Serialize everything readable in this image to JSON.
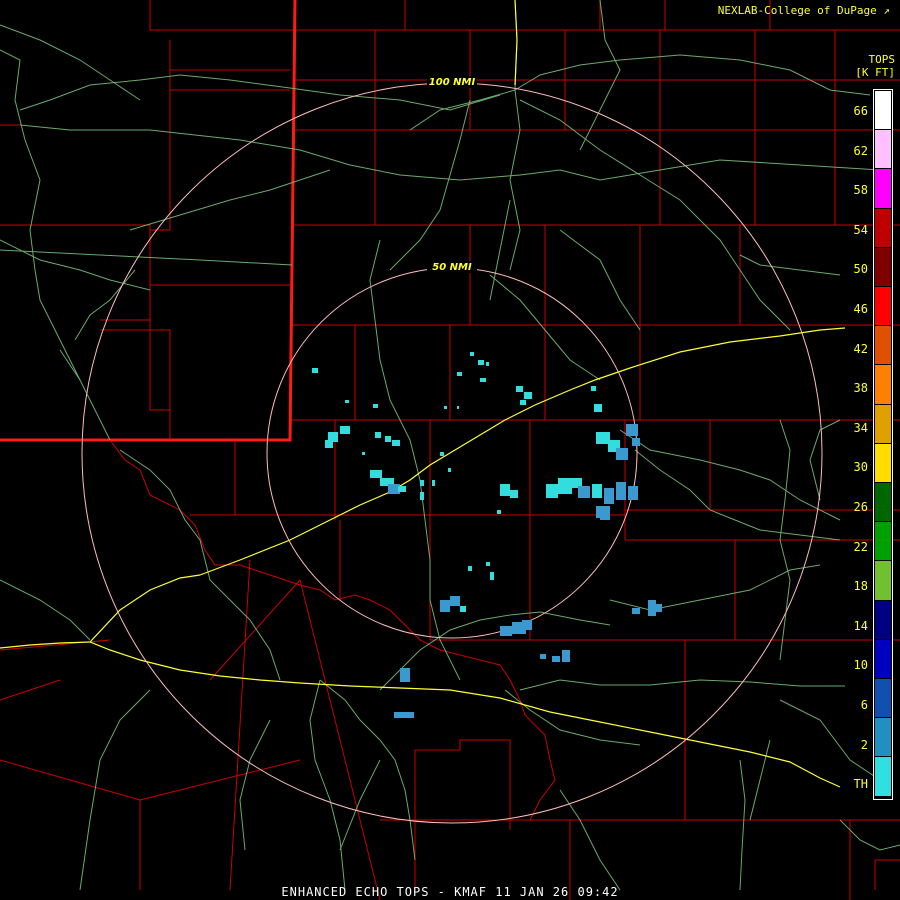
{
  "credit": "NEXLAB-College of DuPage",
  "footer": "ENHANCED ECHO TOPS - KMAF 11 JAN 26 09:42",
  "legend": {
    "title_line1": "TOPS",
    "title_line2": "[K FT]",
    "labels": [
      "66",
      "62",
      "58",
      "54",
      "50",
      "46",
      "42",
      "38",
      "34",
      "30",
      "26",
      "22",
      "18",
      "14",
      "10",
      "6",
      "2",
      "TH"
    ],
    "colors": [
      "#ffffff",
      "#ffc0ff",
      "#ff00ff",
      "#c00000",
      "#800000",
      "#ff0000",
      "#e05000",
      "#ff8000",
      "#e0a000",
      "#ffdd00",
      "#006600",
      "#00a000",
      "#70c030",
      "#000080",
      "#0000c0",
      "#1050b0",
      "#2090c0",
      "#30e0e0"
    ]
  },
  "range_rings": [
    {
      "label": "100 NMI",
      "radius_nmi": 100
    },
    {
      "label": "50 NMI",
      "radius_nmi": 50
    }
  ],
  "colors": {
    "county_lines": "#cc0000",
    "state_line": "#ff1a1a",
    "rivers_roads": "#7ec87e",
    "interstates": "#ffff33",
    "range_rings": "#ffbcbc",
    "echo_light": "#33dddd",
    "echo_medium": "#3a9ad0"
  }
}
